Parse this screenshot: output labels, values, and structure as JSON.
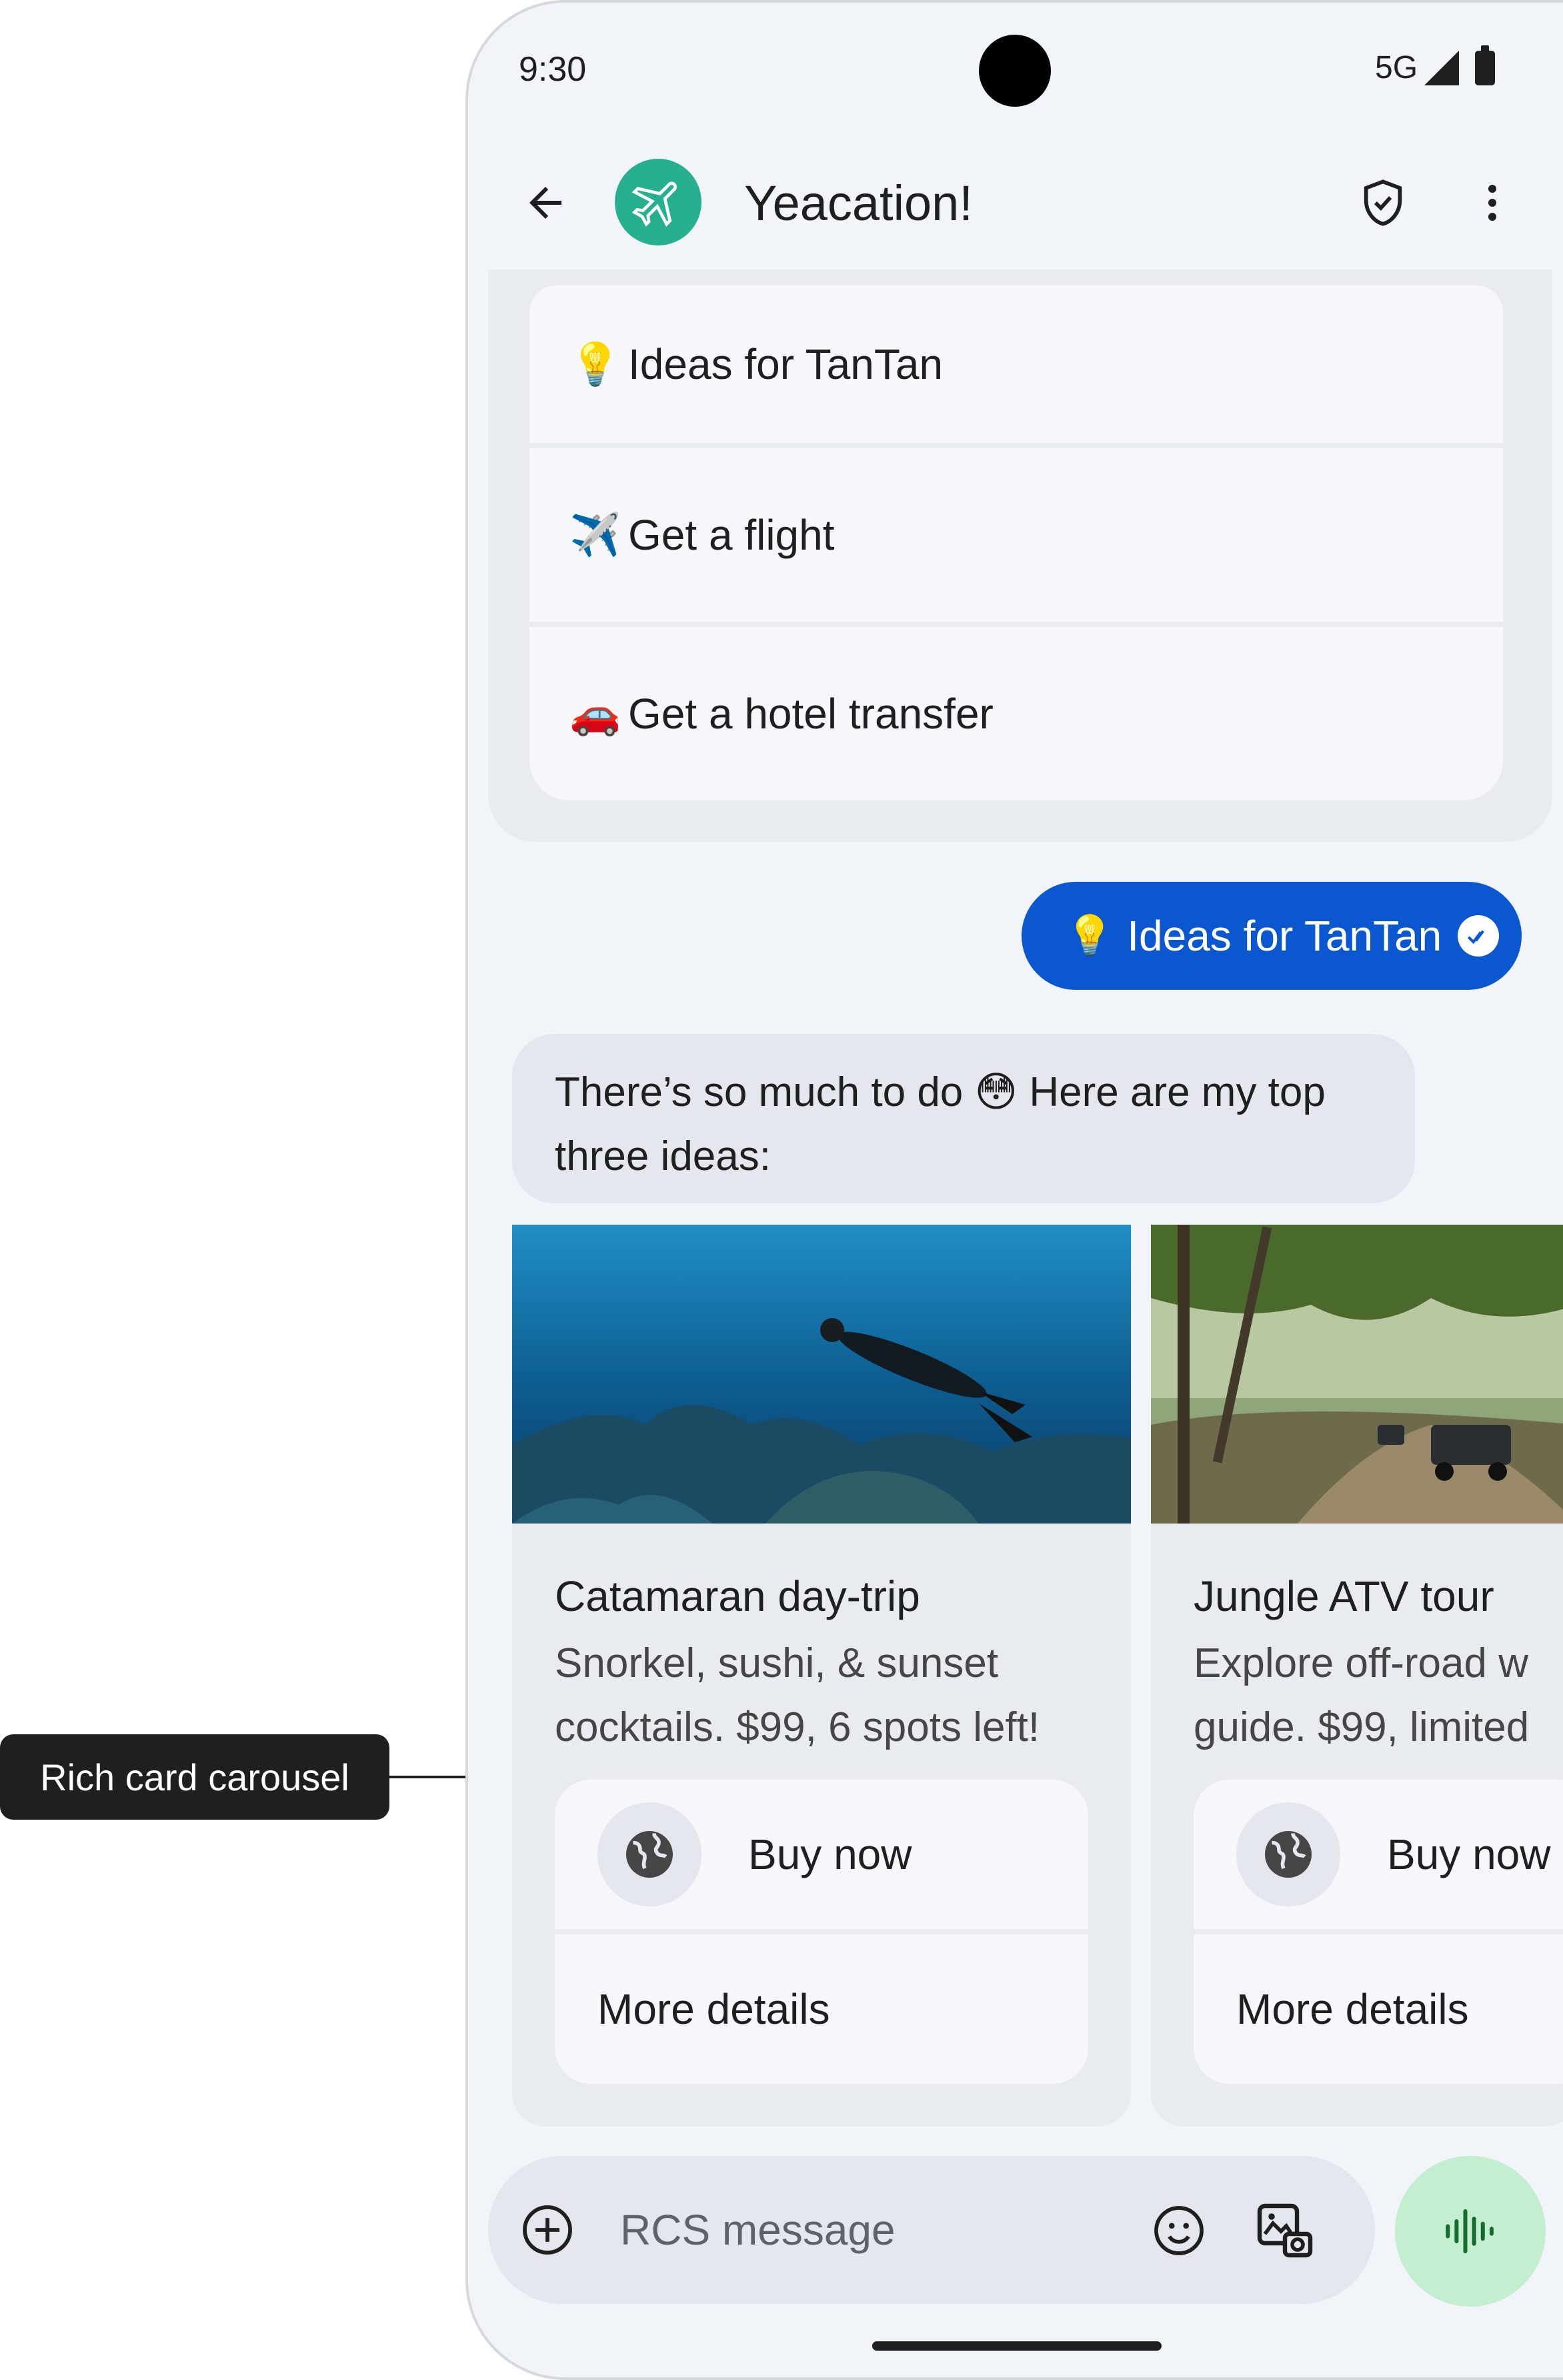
{
  "callout": {
    "label": "Rich card carousel"
  },
  "status_bar": {
    "time": "9:30",
    "network": "5G"
  },
  "app_bar": {
    "title": "Yeacation!"
  },
  "suggestions": [
    {
      "emoji": "💡",
      "label": "Ideas for TanTan"
    },
    {
      "emoji": "✈️",
      "label": "Get a flight"
    },
    {
      "emoji": "🚗",
      "label": "Get a hotel transfer"
    }
  ],
  "sent_message": {
    "emoji": "💡",
    "text": "Ideas for TanTan"
  },
  "received_message": {
    "text": "There’s so much to do 😳 Here are my top three ideas:"
  },
  "cards": [
    {
      "title": "Catamaran day-trip",
      "description": "Snorkel, sushi, & sunset\ncocktails. $99, 6 spots left!",
      "buy_label": "Buy now",
      "details_label": "More details"
    },
    {
      "title": "Jungle ATV tour",
      "description": "Explore off-road w\nguide. $99, limited",
      "buy_label": "Buy now",
      "details_label": "More details"
    }
  ],
  "compose": {
    "placeholder": "RCS message"
  },
  "colors": {
    "background": "#f1f4f8",
    "sent_bubble": "#0b57d0",
    "avatar": "#26b08f",
    "voice_button": "#c4eed0",
    "voice_icon": "#146c2e"
  },
  "icons": [
    "back-arrow-icon",
    "airplane-icon",
    "shield-check-icon",
    "more-vert-icon",
    "check-circle-icon",
    "globe-icon",
    "plus-circle-icon",
    "emoji-icon",
    "gallery-icon",
    "voice-wave-icon"
  ]
}
